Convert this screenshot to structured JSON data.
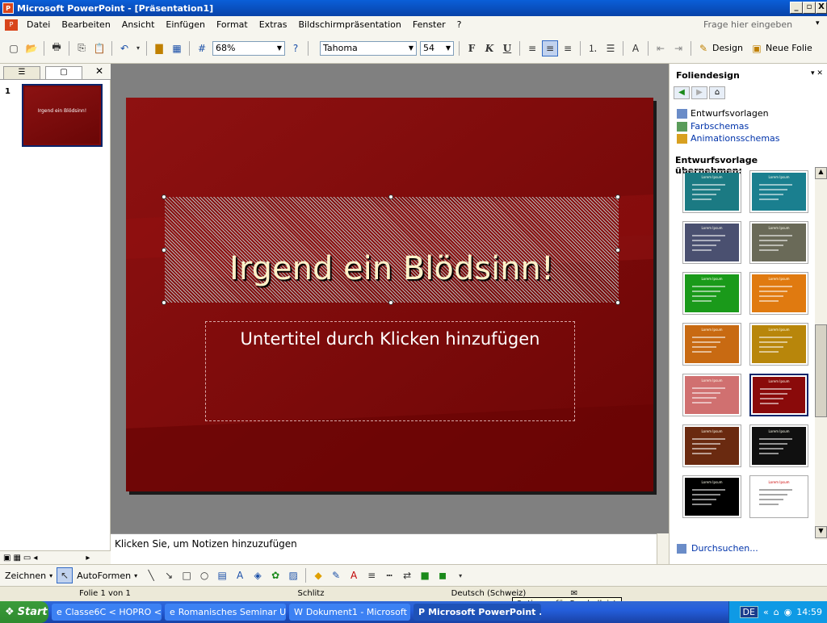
{
  "window": {
    "title": "Microsoft PowerPoint - [Präsentation1]",
    "icon": "powerpoint-icon",
    "controls": [
      "_",
      "▫",
      "X"
    ]
  },
  "menu": {
    "items": [
      "Datei",
      "Bearbeiten",
      "Ansicht",
      "Einfügen",
      "Format",
      "Extras",
      "Bildschirmpräsentation",
      "Fenster",
      "?"
    ],
    "help_placeholder": "Frage hier eingeben"
  },
  "toolbar": {
    "zoom": "68%",
    "font": "Tahoma",
    "font_size": "54",
    "bold": "F",
    "italic": "K",
    "underline": "U",
    "design_label": "Design",
    "new_slide_label": "Neue Folie"
  },
  "thumbs": {
    "slide_number": "1",
    "slide_title": "Irgend ein Blödsinn!"
  },
  "slide": {
    "title": "Irgend ein Blödsinn!",
    "subtitle_placeholder": "Untertitel durch Klicken hinzufügen"
  },
  "notes": {
    "placeholder": "Klicken Sie, um Notizen hinzuzufügen"
  },
  "task_pane": {
    "title": "Foliendesign",
    "links": [
      "Entwurfsvorlagen",
      "Farbschemas",
      "Animationsschemas"
    ],
    "apply_heading": "Entwurfsvorlage übernehmen:",
    "template_label": "Lorem Ipsum",
    "browse": "Durchsuchen..."
  },
  "templates": [
    {
      "bg": "#1b7a83",
      "style": "teal"
    },
    {
      "bg": "#1a7f8f",
      "style": "teal2"
    },
    {
      "bg": "#4a5070",
      "style": "slate"
    },
    {
      "bg": "#6a6a58",
      "style": "olive"
    },
    {
      "bg": "#1a9a1a",
      "style": "green"
    },
    {
      "bg": "#e07a10",
      "style": "orange"
    },
    {
      "bg": "#c86a12",
      "style": "amber"
    },
    {
      "bg": "#b8860b",
      "style": "gold"
    },
    {
      "bg": "#d07070",
      "style": "rose"
    },
    {
      "bg": "#8a0a0a",
      "style": "darkred"
    },
    {
      "bg": "#6a2a10",
      "style": "brown"
    },
    {
      "bg": "#101010",
      "style": "fireworks"
    },
    {
      "bg": "#000000",
      "style": "black"
    },
    {
      "bg": "#ffffff",
      "style": "white"
    }
  ],
  "drawing": {
    "label": "Zeichnen",
    "autoshapes": "AutoFormen"
  },
  "status": {
    "slide": "Folie 1 von 1",
    "design": "Schlitz",
    "language": "Deutsch (Schweiz)"
  },
  "tooltip": "Optionen für Symbolleisten",
  "taskbar": {
    "start": "Start",
    "tasks": [
      {
        "label": "Classe6C < HOPRO < wi...",
        "icon": "ie-icon",
        "active": false
      },
      {
        "label": "Romanisches Seminar Un...",
        "icon": "ie-icon",
        "active": false
      },
      {
        "label": "Dokument1 - Microsoft ...",
        "icon": "word-icon",
        "active": false
      },
      {
        "label": "Microsoft PowerPoint ...",
        "icon": "powerpoint-icon",
        "active": true
      }
    ],
    "lang": "DE",
    "clock": "14:59"
  }
}
